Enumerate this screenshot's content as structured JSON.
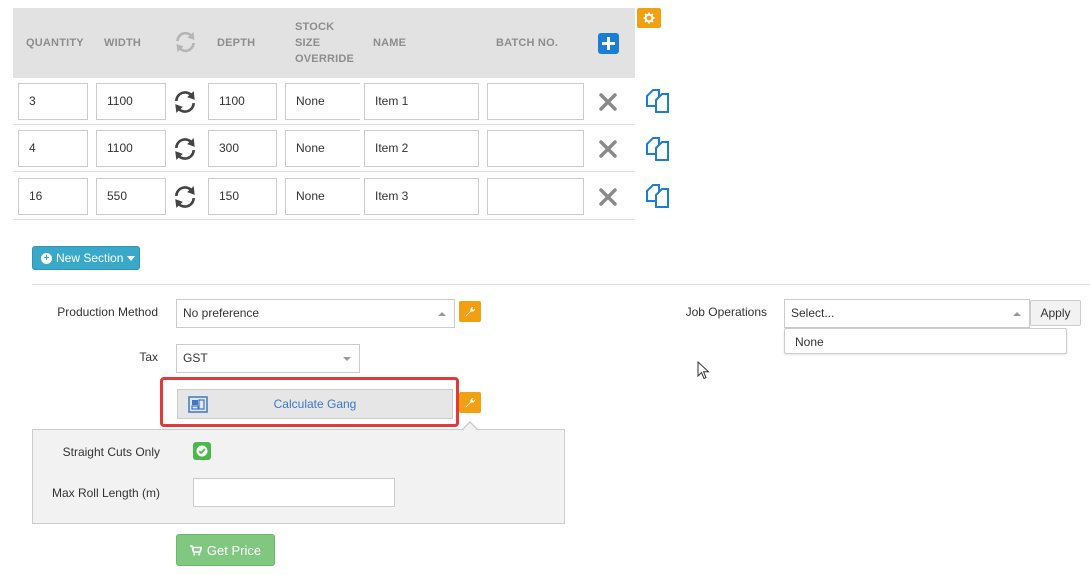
{
  "colors": {
    "accent_orange": "#f0a010",
    "accent_blue": "#1a7fd4",
    "new_section_bg": "#3aa9c9",
    "get_price_bg": "#80c880",
    "highlight_red": "#e03a3a",
    "header_bg": "#e2e2e2"
  },
  "table": {
    "headers": {
      "quantity": "QUANTITY",
      "width": "WIDTH",
      "depth": "DEPTH",
      "stock_line1": "STOCK",
      "stock_line2": "SIZE",
      "stock_line3": "OVERRIDE",
      "name": "NAME",
      "batch": "BATCH NO."
    },
    "rows": [
      {
        "quantity": "3",
        "width": "1100",
        "depth": "1100",
        "stock": "None",
        "name": "Item 1",
        "batch": ""
      },
      {
        "quantity": "4",
        "width": "1100",
        "depth": "300",
        "stock": "None",
        "name": "Item 2",
        "batch": ""
      },
      {
        "quantity": "16",
        "width": "550",
        "depth": "150",
        "stock": "None",
        "name": "Item 3",
        "batch": ""
      }
    ]
  },
  "toolbar": {
    "new_section_label": "New Section"
  },
  "form": {
    "production_method_label": "Production Method",
    "production_method_value": "No preference",
    "tax_label": "Tax",
    "tax_value": "GST",
    "calculate_gang_label": "Calculate Gang",
    "straight_cuts_label": "Straight Cuts Only",
    "straight_cuts_checked": true,
    "max_roll_length_label": "Max Roll Length (m)",
    "max_roll_length_value": "",
    "get_price_label": "Get Price"
  },
  "job_operations": {
    "label": "Job Operations",
    "placeholder": "Select...",
    "apply_label": "Apply",
    "options": [
      "None"
    ]
  },
  "icons": [
    "sync-icon",
    "add-icon",
    "gear-icon",
    "delete-icon",
    "copy-icon",
    "wrench-icon",
    "gang-layout-icon",
    "check-icon",
    "cart-icon",
    "mouse-cursor-icon"
  ]
}
